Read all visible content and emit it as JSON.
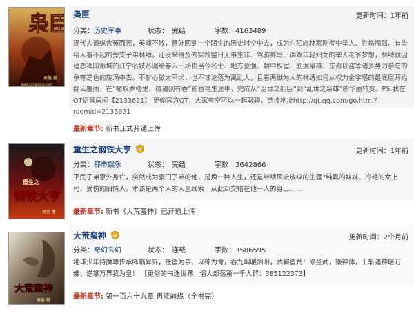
{
  "books": [
    {
      "title": "枭臣",
      "updated": "更新时间：1年前",
      "category_label": "分类：",
      "category": "历史军事",
      "status": "状态：　完结",
      "words": "字数：4163489",
      "description": "现代人谭纵含冤而死，英魂不散，意外回到一个陌生的历史时空中去，成为东阳府林家刚考中举人、性格懦弱、有些给人看不起的旁支子弟林缚。还没来得及去实践整日无事生非、驾驹养鸟、调戏年轻妇女的举人老爷梦想，林缚就因建恋裨国赈城的江宁名妓苏湄给卷入一场由当今名士、地方豪强、朝中权宦、割据枭雄、东海以盗等诸多势力参与的争夺逆色的旋涡中去。不甘心做太平犬，也不甘沦落为离乱人，且看两世为人的林缚如何从权力金字塔的最底层开始翻云覆雨，在“嗷叹罗稽里、祷谴别有香”的香艳生涯中，完成从“治世之能臣”到“乱世之枭雄”的华丽转变。PS:我在QT语音房间【2133621】 更偷官方QT，大家有空可以一起聊聊。链接地址http://qt.qq.com/go.html?roomid=2133621",
      "latest_label": "最新章节:",
      "latest": "新书正式开通上传",
      "cover_title": "枭臣",
      "cover_author": "更俗 著",
      "cover_url": "www.zongheng.com",
      "has_badge": false
    },
    {
      "title": "重生之钢铁大亨",
      "updated": "更新时间：1年前",
      "category_label": "分类：",
      "category": "都市娱乐",
      "status": "状态：　完结",
      "words": "字数：3642866",
      "description": "平民子弟意外身亡，突然成为豪门子弟的他，是换一种人生，还是继续风流放纵的生涯?纯真的妹妹、冷艳的女上司、受伤的旧情人。本该是两个人的人生线索，从此却交错在他一人的身上……",
      "latest_label": "最新章节:",
      "latest": "新书《大荒蛮神》已开通上传",
      "cover_title": "钢铁大亨",
      "cover_prefix": "重生之",
      "cover_author": "更俗 著",
      "has_badge": true
    },
    {
      "title": "大荒蛮神",
      "updated": "更新时间：2个月前",
      "category_label": "分类：",
      "category": "奇幻玄幻",
      "status": "状态：　连载",
      "words": "字数：3586595",
      "description": "地球少年持魔尊传承降临异界，任蛮为亲，以神为骨，吞九幽暖阴阳，武霸蛮荒！修圣武，锻神体，上斩诸神屠万佛，逆掌万界我为皇！ 【更俗的书迷世界，俗人部落第一千人群：385122373】",
      "latest_label": "最新章节:",
      "latest": "第一百六十九章 再续前缘（全书完）",
      "cover_title": "大荒蛮神",
      "cover_author": "更俗 著",
      "has_badge": true
    }
  ],
  "colors": {
    "title": "#123a7a",
    "latest_label": "#c0392b",
    "badge": "#e8a91a"
  }
}
